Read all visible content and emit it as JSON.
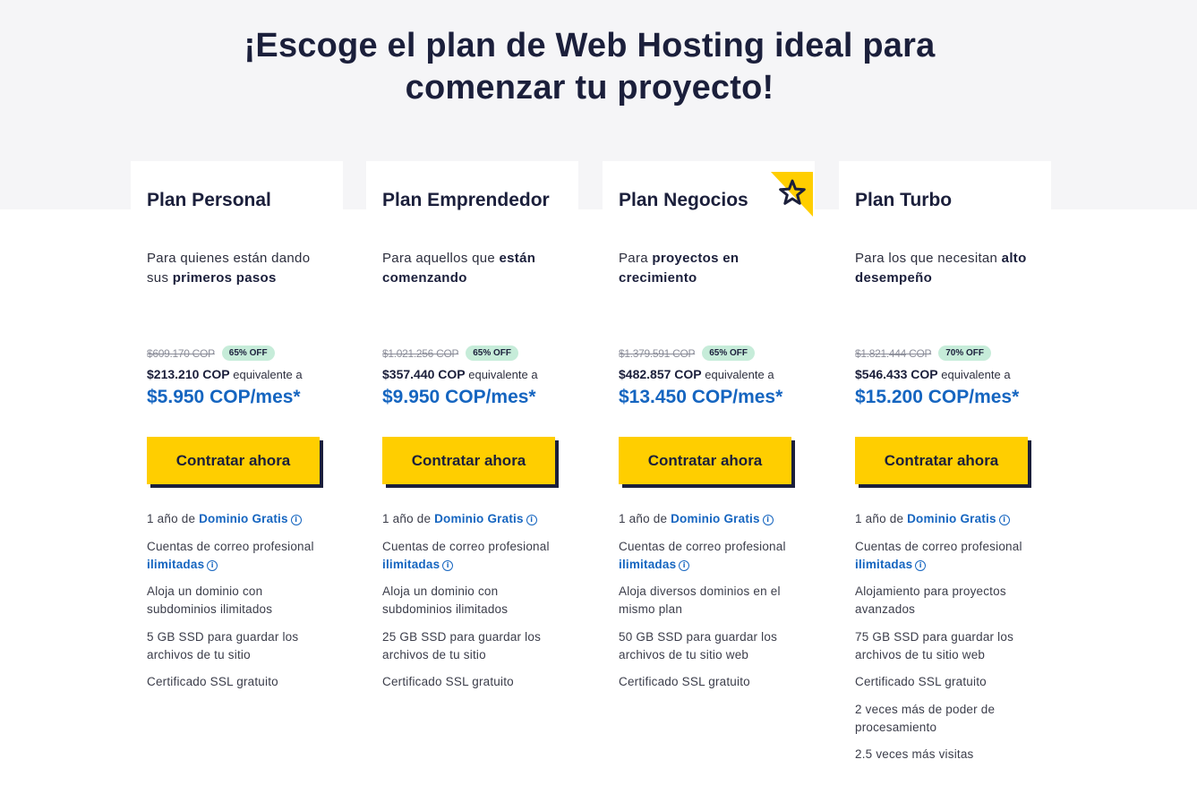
{
  "headline": {
    "line1": "¡Escoge el plan de Web Hosting ideal para",
    "line2": "comenzar tu proyecto!"
  },
  "plans": [
    {
      "title": "Plan Personal",
      "desc_pre": "Para quienes están dando sus ",
      "desc_bold": "primeros pasos",
      "desc_post": "",
      "old_price": "$609.170 COP",
      "discount": "65% OFF",
      "year_price": "$213.210 COP",
      "year_suffix": " equivalente a",
      "monthly": "$5.950 COP/mes*",
      "cta": "Contratar ahora",
      "features": [
        {
          "pre": "1 año de ",
          "hl": "Dominio Gratis",
          "info": true
        },
        {
          "pre": "Cuentas de correo profesional ",
          "hl": "ilimitadas",
          "info": true
        },
        {
          "pre": "Aloja un dominio con subdominios ilimitados"
        },
        {
          "pre": "5 GB SSD para guardar los archivos de tu sitio"
        },
        {
          "pre": "Certificado SSL gratuito"
        }
      ]
    },
    {
      "title": "Plan Emprendedor",
      "desc_pre": "Para aquellos que ",
      "desc_bold": "están comenzando",
      "desc_post": "",
      "old_price": "$1.021.256 COP",
      "discount": "65% OFF",
      "year_price": "$357.440 COP",
      "year_suffix": " equivalente a",
      "monthly": "$9.950 COP/mes*",
      "cta": "Contratar ahora",
      "features": [
        {
          "pre": "1 año de ",
          "hl": "Dominio Gratis",
          "info": true
        },
        {
          "pre": "Cuentas de correo profesional ",
          "hl": "ilimitadas",
          "info": true
        },
        {
          "pre": "Aloja un dominio con subdominios ilimitados"
        },
        {
          "pre": "25 GB SSD para guardar los archivos de tu sitio"
        },
        {
          "pre": "Certificado SSL gratuito"
        }
      ]
    },
    {
      "title": "Plan Negocios",
      "desc_pre": "Para ",
      "desc_bold": "proyectos en crecimiento",
      "desc_post": "",
      "old_price": "$1.379.591 COP",
      "discount": "65% OFF",
      "year_price": "$482.857 COP",
      "year_suffix": " equivalente a",
      "monthly": "$13.450 COP/mes*",
      "cta": "Contratar ahora",
      "featured": true,
      "features": [
        {
          "pre": "1 año de ",
          "hl": "Dominio Gratis",
          "info": true
        },
        {
          "pre": "Cuentas de correo profesional ",
          "hl": "ilimitadas",
          "info": true
        },
        {
          "pre": "Aloja diversos dominios en el mismo plan"
        },
        {
          "pre": "50 GB SSD para guardar los archivos de tu sitio web"
        },
        {
          "pre": "Certificado SSL gratuito"
        }
      ]
    },
    {
      "title": "Plan Turbo",
      "desc_pre": "Para los que necesitan ",
      "desc_bold": "alto desempeño",
      "desc_post": "",
      "old_price": "$1.821.444 COP",
      "discount": "70% OFF",
      "year_price": "$546.433 COP",
      "year_suffix": " equivalente a",
      "monthly": "$15.200 COP/mes*",
      "cta": "Contratar ahora",
      "features": [
        {
          "pre": "1 año de ",
          "hl": "Dominio Gratis",
          "info": true
        },
        {
          "pre": "Cuentas de correo profesional ",
          "hl": "ilimitadas",
          "info": true
        },
        {
          "pre": "Alojamiento para proyectos avanzados"
        },
        {
          "pre": "75 GB SSD para guardar los archivos de tu sitio web"
        },
        {
          "pre": "Certificado SSL gratuito"
        },
        {
          "pre": "2 veces más de poder de procesamiento"
        },
        {
          "pre": "2.5 veces más visitas"
        }
      ]
    }
  ],
  "colors": {
    "accent_yellow": "#ffce00",
    "navy": "#1b1f3b",
    "link_blue": "#1565c0",
    "badge_green": "#c6ecd9"
  },
  "icons": {
    "featured": "star-icon",
    "info": "info-circle-icon"
  }
}
